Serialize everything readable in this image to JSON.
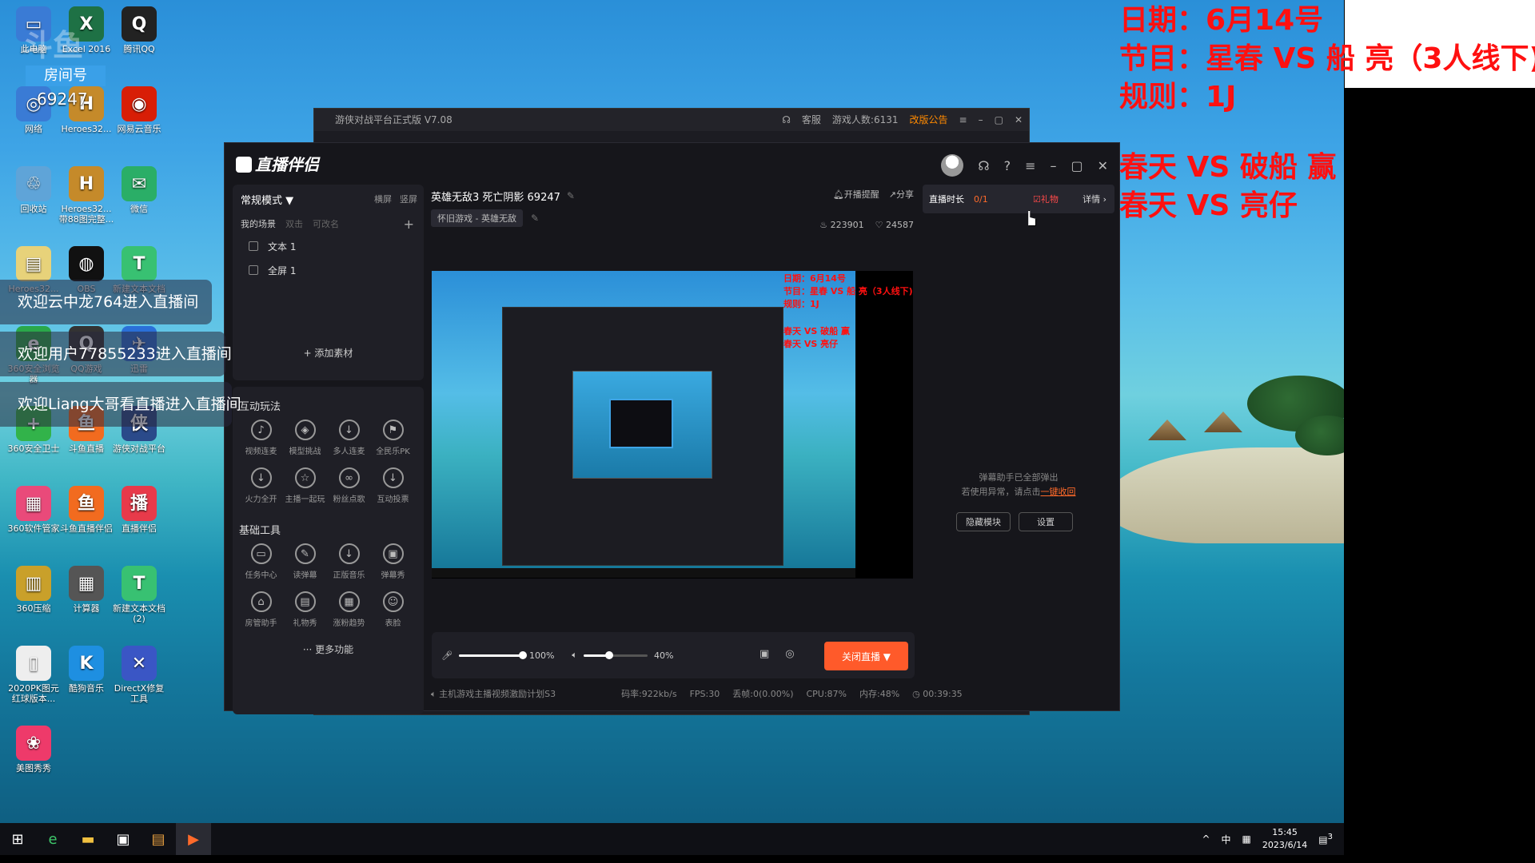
{
  "overlay": {
    "line1": "日期：6月14号",
    "line2": "节目：星春 VS 船 亮（3人线下)",
    "line3": "规则：1J",
    "line4": "春天 VS 破船 赢",
    "line5": "春天 VS 亮仔"
  },
  "desktop": {
    "watermark_top": "斗鱼",
    "room_label": "房间号",
    "room_number": "69247",
    "icons": [
      {
        "label": "此电脑",
        "glyph": "▭",
        "color": "#3a7bd5"
      },
      {
        "label": "Excel 2016",
        "glyph": "X",
        "color": "#1e7145"
      },
      {
        "label": "腾讯QQ",
        "glyph": "Q",
        "color": "#222222"
      },
      {
        "label": "网络",
        "glyph": "◎",
        "color": "#3a7bd5"
      },
      {
        "label": "Heroes32...",
        "glyph": "H",
        "color": "#c58a2a"
      },
      {
        "label": "网易云音乐",
        "glyph": "◉",
        "color": "#d81e06"
      },
      {
        "label": "回收站",
        "glyph": "♲",
        "color": "#5fa4d8"
      },
      {
        "label": "Heroes32... 带88图完整...",
        "glyph": "H",
        "color": "#c58a2a"
      },
      {
        "label": "微信",
        "glyph": "✉",
        "color": "#2aae67"
      },
      {
        "label": "Heroes32...",
        "glyph": "▤",
        "color": "#e7d27a"
      },
      {
        "label": "OBS",
        "glyph": "◍",
        "color": "#111111"
      },
      {
        "label": "新建文本文档",
        "glyph": "T",
        "color": "#38c172"
      },
      {
        "label": "360安全浏览器",
        "glyph": "e",
        "color": "#2aa84a"
      },
      {
        "label": "QQ游戏",
        "glyph": "Q",
        "color": "#333333"
      },
      {
        "label": "迅雷",
        "glyph": "✈",
        "color": "#2a6fd8"
      },
      {
        "label": "360安全卫士",
        "glyph": "+",
        "color": "#32b34a"
      },
      {
        "label": "斗鱼直播",
        "glyph": "鱼",
        "color": "#f26b1f"
      },
      {
        "label": "游侠对战平台",
        "glyph": "侠",
        "color": "#2a4a8a"
      },
      {
        "label": "360软件管家",
        "glyph": "▦",
        "color": "#e94a7a"
      },
      {
        "label": "斗鱼直播伴侣",
        "glyph": "鱼",
        "color": "#f26b1f"
      },
      {
        "label": "直播伴侣",
        "glyph": "播",
        "color": "#e83a4a"
      },
      {
        "label": "360压缩",
        "glyph": "▥",
        "color": "#c9a02a"
      },
      {
        "label": "计算器",
        "glyph": "▦",
        "color": "#555555"
      },
      {
        "label": "新建文本文档 (2)",
        "glyph": "T",
        "color": "#38c172"
      },
      {
        "label": "2020PK图元 红球版本...",
        "glyph": "▯",
        "color": "#eeeeee"
      },
      {
        "label": "酷狗音乐",
        "glyph": "K",
        "color": "#1e8fe1"
      },
      {
        "label": "DirectX修复工具",
        "glyph": "✕",
        "color": "#3a56c5"
      },
      {
        "label": "美图秀秀",
        "glyph": "❀",
        "color": "#ee3a6a"
      }
    ]
  },
  "welcomes": [
    "欢迎云中龙764进入直播间",
    "欢迎用户77855233进入直播间",
    "欢迎Liang大哥看直播进入直播间"
  ],
  "backwin": {
    "title": "游侠对战平台正式版 V7.08",
    "service": "客服",
    "players": "游戏人数:6131",
    "notice": "改版公告"
  },
  "app": {
    "logo": "直播伴侣",
    "mode": "常规模式 ▼",
    "orient_h": "横屏",
    "orient_v": "竖屏",
    "tabs": [
      "我的场景",
      "双击",
      "可改名"
    ],
    "scenes": [
      "文本 1",
      "全屏 1"
    ],
    "add_source": "+ 添加素材",
    "interact_title": "互动玩法",
    "interact_tools": [
      {
        "label": "视频连麦",
        "icon": "mic-icon",
        "glyph": "♪"
      },
      {
        "label": "模型挑战",
        "icon": "shield-icon",
        "glyph": "◈"
      },
      {
        "label": "多人连麦",
        "icon": "download-icon",
        "glyph": "↓"
      },
      {
        "label": "全民乐PK",
        "icon": "flag-icon",
        "glyph": "⚑"
      },
      {
        "label": "火力全开",
        "icon": "download-icon",
        "glyph": "↓"
      },
      {
        "label": "主播一起玩",
        "icon": "star-icon",
        "glyph": "☆"
      },
      {
        "label": "粉丝点歌",
        "icon": "link-icon",
        "glyph": "∞"
      },
      {
        "label": "互动投票",
        "icon": "download-icon",
        "glyph": "↓"
      }
    ],
    "basic_title": "基础工具",
    "basic_tools": [
      {
        "label": "任务中心",
        "icon": "inbox-icon",
        "glyph": "▭"
      },
      {
        "label": "读弹幕",
        "icon": "edit-icon",
        "glyph": "✎"
      },
      {
        "label": "正版音乐",
        "icon": "download-icon",
        "glyph": "↓"
      },
      {
        "label": "弹幕秀",
        "icon": "tv-icon",
        "glyph": "▣"
      },
      {
        "label": "房管助手",
        "icon": "home-icon",
        "glyph": "⌂"
      },
      {
        "label": "礼物秀",
        "icon": "gift-icon",
        "glyph": "▤"
      },
      {
        "label": "涨粉趋势",
        "icon": "chart-icon",
        "glyph": "▦"
      },
      {
        "label": "表脸",
        "icon": "smile-icon",
        "glyph": "☺"
      }
    ],
    "more": "··· 更多功能",
    "stream_title": "英雄无敌3 死亡阴影 69247",
    "start_remind": "开播提醒",
    "share": "分享",
    "category": "怀旧游戏 - 英雄无敌",
    "fans": "223901",
    "likes": "24587",
    "mic_volume": "100%",
    "speaker_volume": "40%",
    "mic_level": 1.0,
    "speaker_level": 0.4,
    "end_button": "关闭直播 ▼",
    "status": {
      "promo": "主机游戏主播视频激励计划S3",
      "bitrate": "码率:922kb/s",
      "fps": "FPS:30",
      "drop": "丢帧:0(0.00%)",
      "cpu": "CPU:87%",
      "mem": "内存:48%",
      "time": "00:39:35"
    },
    "duration_label": "直播时长",
    "duration_value": "0/1",
    "gift": "礼物",
    "detail": "详情 ›",
    "notice_line1": "弹幕助手已全部弹出",
    "notice_line2": "若使用异常，请点击",
    "notice_link": "一键收回",
    "hide_module": "隐藏模块",
    "settings": "设置"
  },
  "preview": {
    "line1": "日期：6月14号",
    "line2": "节目：星春 VS 船 亮（3人线下)",
    "line3": "规则：1J",
    "line4": "春天 VS 破船 赢",
    "line5": "春天 VS 亮仔"
  },
  "taskbar": {
    "time": "15:45",
    "date": "2023/6/14",
    "ime": "中",
    "notif_count": "3"
  }
}
